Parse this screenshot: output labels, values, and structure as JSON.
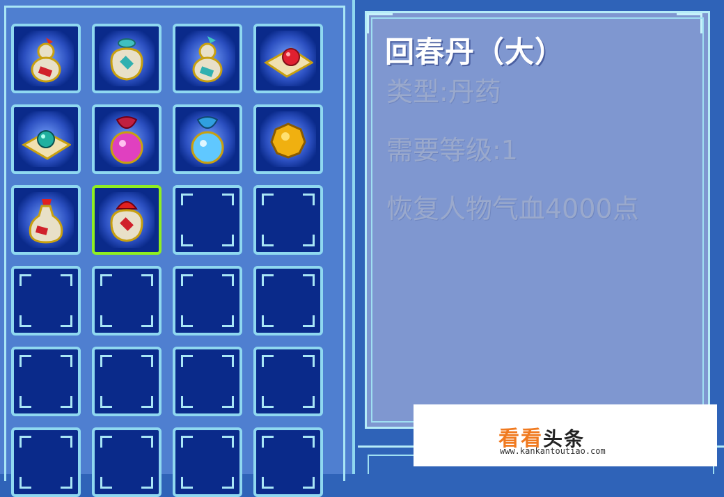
{
  "inventory": {
    "slots": [
      {
        "item": "gourd-red-icon"
      },
      {
        "item": "jar-teal-icon"
      },
      {
        "item": "gourd-teal-icon"
      },
      {
        "item": "red-pill-on-cloth-icon"
      },
      {
        "item": "teal-pill-on-cloth-icon"
      },
      {
        "item": "purple-flask-icon"
      },
      {
        "item": "blue-flask-icon"
      },
      {
        "item": "golden-pill-icon"
      },
      {
        "item": "red-bottle-icon"
      },
      {
        "item": "red-jar-icon",
        "selected": true
      },
      {
        "item": null
      },
      {
        "item": null
      },
      {
        "item": null
      },
      {
        "item": null
      },
      {
        "item": null
      },
      {
        "item": null
      },
      {
        "item": null
      },
      {
        "item": null
      },
      {
        "item": null
      },
      {
        "item": null
      },
      {
        "item": null
      },
      {
        "item": null
      },
      {
        "item": null
      },
      {
        "item": null
      }
    ]
  },
  "detail": {
    "name": "回春丹（大）",
    "type": "类型:丹药",
    "level": "需要等级:1",
    "description": "恢复人物气血4000点"
  },
  "watermark": {
    "brand_orange": "看看",
    "brand_black": "头条",
    "url": "www.kankantoutiao.com"
  },
  "colors": {
    "slot_bg": "#0a2a8a",
    "slot_border": "#8fd8f0",
    "selected_border": "#8fef20",
    "detail_bg": "#7f97d0",
    "brand_orange": "#f07a20"
  }
}
